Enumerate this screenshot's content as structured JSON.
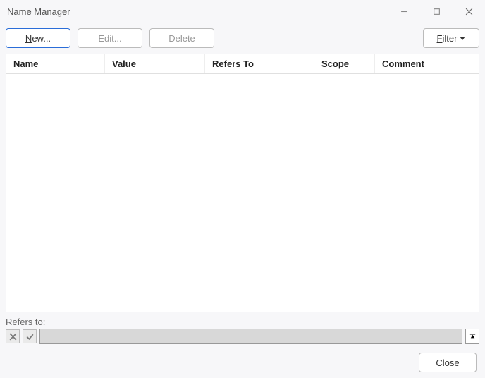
{
  "titlebar": {
    "title": "Name Manager"
  },
  "toolbar": {
    "new_label": "New...",
    "edit_label": "Edit...",
    "delete_label": "Delete",
    "filter_label": "Filter"
  },
  "columns": {
    "name": "Name",
    "value": "Value",
    "refers_to": "Refers To",
    "scope": "Scope",
    "comment": "Comment"
  },
  "rows": [],
  "refers": {
    "label": "Refers to:",
    "value": ""
  },
  "footer": {
    "close_label": "Close"
  }
}
